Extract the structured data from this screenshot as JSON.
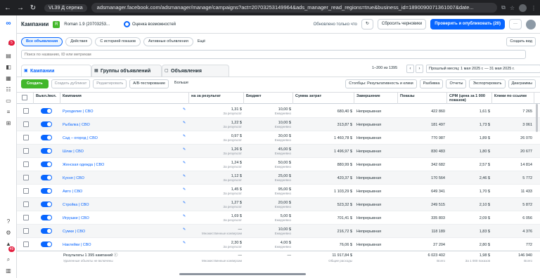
{
  "browser": {
    "tab_label": "VL39 Д сережа",
    "url": "adsmanager.facebook.com/adsmanager/manage/campaigns?act=20703253149964&ads_manager_read_regions=true&business_id=1890090071361007&date..."
  },
  "rail": {
    "notification_count": "5",
    "bottom_count": "49"
  },
  "header": {
    "title": "Кампании",
    "account": "Roman 1.9 (20703253...",
    "opportunity": "Оценка возможностей",
    "updated": "Обновлено только что",
    "discard": "Сбросить черновики",
    "publish": "Проверить и опубликовать (20)"
  },
  "filters": {
    "items": [
      "Все объявления",
      "Действия",
      "С историей показов",
      "Активные объявления"
    ],
    "more": "Ещё",
    "create_view": "Создать вид"
  },
  "search": {
    "placeholder": "Поиск по названию, ID или метрикам"
  },
  "tabs": {
    "campaigns": "Кампании",
    "adsets": "Группы объявлений",
    "ads": "Объявления",
    "range": "1–200 из 1395",
    "period": "Прошлый месяц: 1 мая 2025 г. — 31 мая 2025 г."
  },
  "toolbar": {
    "create": "Создать",
    "duplicate": "Создать дубликат",
    "edit": "Редактировать",
    "ab_test": "A/B-тестирование",
    "more": "Больше",
    "columns": "Столбцы: Результативность и клики",
    "breakdown": "Разбивка",
    "reports": "Отчеты",
    "export": "Экспортировать",
    "charts": "Диаграммы"
  },
  "columns": [
    "Выкл./вкл.",
    "Кампания",
    "на за результат",
    "Бюджет",
    "Сумма затрат",
    "Завершение",
    "Показы",
    "CPM (цена за 1 000 показов)",
    "Клики по ссылке"
  ],
  "rows": [
    {
      "name": "Рукоделие | СВО",
      "cpr": "1,31 $",
      "cpr_sub": "За результат",
      "budget": "10,00 $",
      "budget_sub": "Ежедневно",
      "spent": "680,40 $",
      "end": "Непрерывная",
      "impr": "422 860",
      "cpm": "1,61 $",
      "clicks": "7 265"
    },
    {
      "name": "Рыбалка | СВО",
      "cpr": "1,22 $",
      "cpr_sub": "За результат",
      "budget": "10,00 $",
      "budget_sub": "Ежедневно",
      "spent": "313,87 $",
      "end": "Непрерывная",
      "impr": "181 497",
      "cpm": "1,73 $",
      "clicks": "3 061"
    },
    {
      "name": "Сад – огород | СВО",
      "cpr": "0,97 $",
      "cpr_sub": "За результат",
      "budget": "30,00 $",
      "budget_sub": "Ежедневно",
      "spent": "1 460,78 $",
      "end": "Непрерывная",
      "impr": "770 987",
      "cpm": "1,89 $",
      "clicks": "26 070"
    },
    {
      "name": "Шлак | СВО",
      "cpr": "1,26 $",
      "cpr_sub": "За результат",
      "budget": "45,00 $",
      "budget_sub": "Ежедневно",
      "spent": "1 496,97 $",
      "end": "Непрерывная",
      "impr": "830 483",
      "cpm": "1,80 $",
      "clicks": "20 677"
    },
    {
      "name": "Женская одежда | СВО",
      "cpr": "1,24 $",
      "cpr_sub": "За результат",
      "budget": "50,00 $",
      "budget_sub": "Ежедневно",
      "spent": "880,99 $",
      "end": "Непрерывная",
      "impr": "342 682",
      "cpm": "2,57 $",
      "clicks": "14 814"
    },
    {
      "name": "Кухня | СВО",
      "cpr": "1,12 $",
      "cpr_sub": "За результат",
      "budget": "25,00 $",
      "budget_sub": "Ежедневно",
      "spent": "420,37 $",
      "end": "Непрерывная",
      "impr": "170 564",
      "cpm": "2,46 $",
      "clicks": "5 772"
    },
    {
      "name": "Авто | СВО",
      "cpr": "1,45 $",
      "cpr_sub": "За результат",
      "budget": "95,00 $",
      "budget_sub": "Ежедневно",
      "spent": "1 103,29 $",
      "end": "Непрерывная",
      "impr": "649 341",
      "cpm": "1,70 $",
      "clicks": "11 433"
    },
    {
      "name": "Стройка | СВО",
      "cpr": "1,27 $",
      "cpr_sub": "За результат",
      "budget": "20,00 $",
      "budget_sub": "Ежедневно",
      "spent": "523,32 $",
      "end": "Непрерывная",
      "impr": "249 515",
      "cpm": "2,10 $",
      "clicks": "5 872"
    },
    {
      "name": "Игрушки | СВО",
      "cpr": "1,69 $",
      "cpr_sub": "За результат",
      "budget": "5,00 $",
      "budget_sub": "Ежедневно",
      "spent": "701,41 $",
      "end": "Непрерывная",
      "impr": "335 803",
      "cpm": "2,09 $",
      "clicks": "6 056"
    },
    {
      "name": "Сумки | СВО",
      "cpr": "—",
      "cpr_sub": "Множественные конверсии",
      "budget": "10,00 $",
      "budget_sub": "Ежедневно",
      "spent": "216,72 $",
      "end": "Непрерывная",
      "impr": "118 189",
      "cpm": "1,83 $",
      "clicks": "4 376"
    },
    {
      "name": "Наклейки | СВО",
      "cpr": "2,30 $",
      "cpr_sub": "За результат",
      "budget": "4,00 $",
      "budget_sub": "Ежедневно",
      "spent": "76,06 $",
      "end": "Непрерывная",
      "impr": "27 204",
      "cpm": "2,80 $",
      "clicks": "772"
    }
  ],
  "footer": {
    "label": "Результаты 1 395 кампаний",
    "sub": "Удаленные объекты не включены",
    "cpr": "—",
    "cpr_sub": "Множественные конверсии",
    "budget": "—",
    "spent": "11 917,84 $",
    "spent_sub": "Общие расходы",
    "impr": "6 023 402",
    "impr_sub": "Всего",
    "cpm": "1,98 $",
    "cpm_sub": "За 1 000 показов",
    "clicks": "146 940",
    "clicks_sub": "Всего"
  }
}
